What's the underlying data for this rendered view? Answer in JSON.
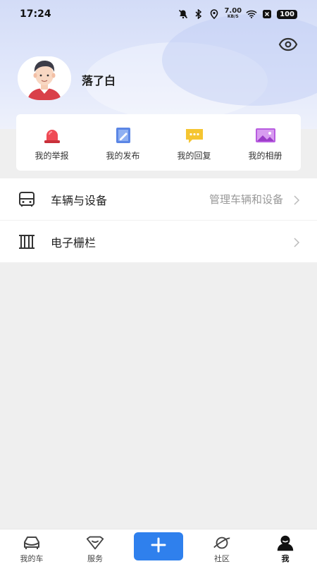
{
  "status_bar": {
    "time": "17:24",
    "net_speed_value": "7.00",
    "net_speed_unit": "KB/S",
    "battery": "100",
    "icons": [
      "mute-icon",
      "bluetooth-icon",
      "location-icon",
      "wifi-icon",
      "sim-icon"
    ]
  },
  "profile": {
    "username": "落了白",
    "settings_icon": "eye-icon"
  },
  "quick_actions": [
    {
      "label": "我的举报",
      "icon": "alarm-light-icon"
    },
    {
      "label": "我的发布",
      "icon": "edit-note-icon"
    },
    {
      "label": "我的回复",
      "icon": "chat-bubble-icon"
    },
    {
      "label": "我的相册",
      "icon": "photo-album-icon"
    }
  ],
  "menu": [
    {
      "title": "车辆与设备",
      "subtitle": "管理车辆和设备",
      "icon": "vehicle-icon"
    },
    {
      "title": "电子栅栏",
      "subtitle": "",
      "icon": "fence-icon"
    }
  ],
  "tabbar": {
    "tabs": [
      {
        "label": "我的车",
        "icon": "car-icon"
      },
      {
        "label": "服务",
        "icon": "service-icon"
      },
      {
        "label": "社区",
        "icon": "planet-icon"
      },
      {
        "label": "我",
        "icon": "user-icon"
      }
    ],
    "add_icon": "plus-icon",
    "active": "我"
  },
  "colors": {
    "accent": "#2f80ed",
    "header_gradient_top": "#d3dcf7",
    "background": "#efefef"
  }
}
